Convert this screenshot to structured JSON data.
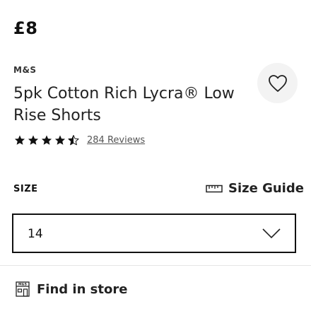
{
  "product": {
    "price": "£8",
    "brand": "M&S",
    "title": "5pk Cotton Rich Lycra® Low Rise Shorts",
    "rating": 4.5,
    "rating_max": 5,
    "reviews_label": "284 Reviews"
  },
  "size": {
    "label": "SIZE",
    "guide_label": "Size Guide",
    "selected": "14"
  },
  "store": {
    "find_label": "Find in store",
    "icon_text": "M&S"
  },
  "icons": {
    "wishlist": "heart-icon",
    "size_guide": "ruler-icon",
    "dropdown": "chevron-down-icon",
    "store": "store-icon"
  },
  "colors": {
    "text": "#111111",
    "wishlist_bg": "#f3f3f3",
    "reviews": "#555555"
  }
}
